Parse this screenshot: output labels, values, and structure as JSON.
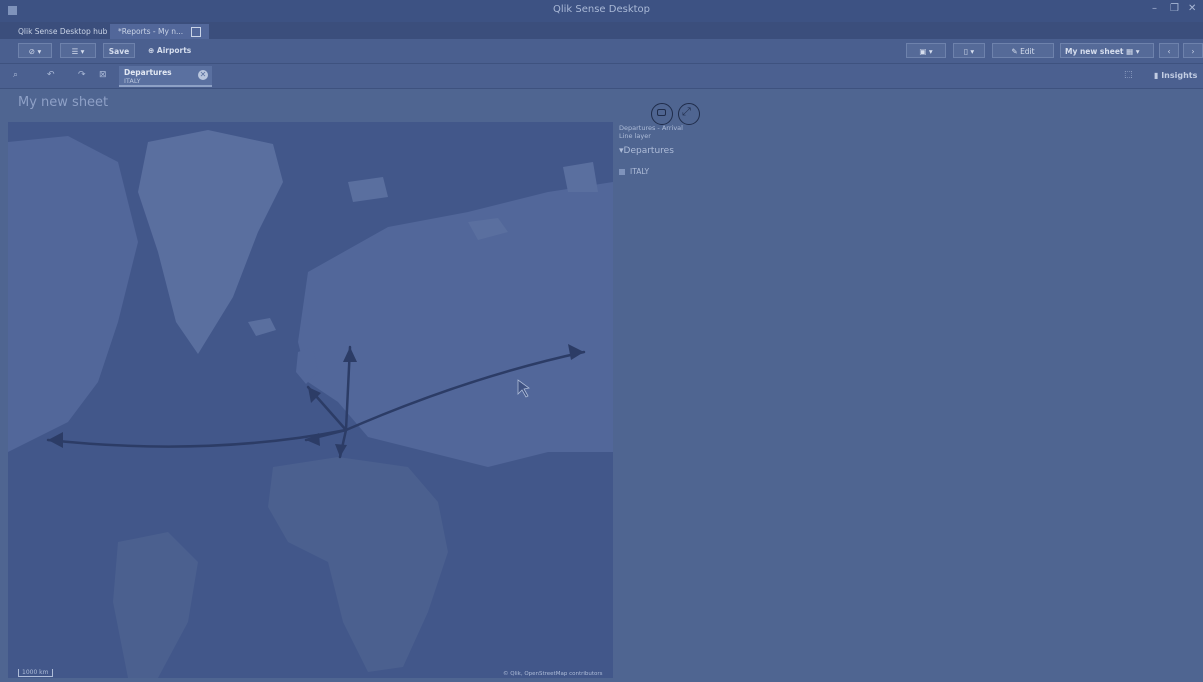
{
  "window": {
    "title": "Qlik Sense Desktop",
    "controls": [
      "–",
      "❐",
      "✕"
    ]
  },
  "tabs": [
    {
      "label": "Qlik Sense Desktop hub"
    },
    {
      "label": "*Reports - My n..."
    }
  ],
  "toolbar": {
    "save_label": "Save",
    "airports_label": "Airports",
    "edit_label": "Edit",
    "sheet_selector_label": "My new sheet"
  },
  "selections": {
    "field": "Departures",
    "value": "ITALY",
    "insights_label": "Insights"
  },
  "sheet": {
    "title": "My new sheet"
  },
  "map": {
    "scale_label": "1000 km",
    "attribution": "© Qlik, OpenStreetMap contributors"
  },
  "legend": {
    "title_line1": "Departures - Arrival",
    "title_line2": "Line layer",
    "group": "Departures",
    "item": "ITALY"
  },
  "colors": {
    "background": "#4f6591",
    "map": "#42578a",
    "lines": "#2c3c66"
  }
}
